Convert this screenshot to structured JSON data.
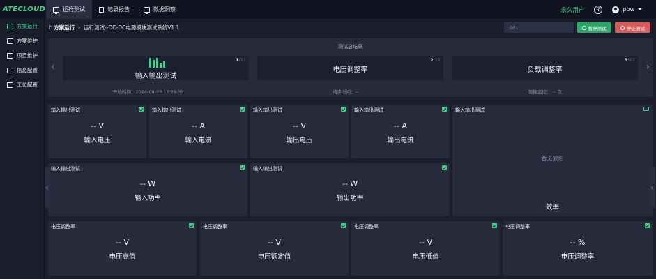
{
  "app": {
    "logo": "ATECLOUD"
  },
  "topnav": [
    {
      "label": "运行测试",
      "icon": "monitor-icon",
      "active": true
    },
    {
      "label": "记录报告",
      "icon": "document-icon",
      "active": false
    },
    {
      "label": "数据洞察",
      "icon": "monitor-icon",
      "active": false
    }
  ],
  "header": {
    "user_type": "永久用户",
    "help": "?",
    "username": "pow"
  },
  "sidebar": [
    {
      "label": "方案运行",
      "active": true
    },
    {
      "label": "方案维护",
      "active": false
    },
    {
      "label": "项目维护",
      "active": false
    },
    {
      "label": "信息配置",
      "active": false
    },
    {
      "label": "工位配置",
      "active": false
    }
  ],
  "breadcrumb": {
    "root": "方案运行",
    "current": "运行测试--DC-DC电源模块测试系统V1.1"
  },
  "search": {
    "value": "001"
  },
  "buttons": {
    "pause": "暂停测试",
    "stop": "停止测试"
  },
  "summary": {
    "title": "测试总结果",
    "stages": [
      {
        "label": "输入输出测试",
        "index": "1",
        "total": "/11"
      },
      {
        "label": "电压调整率",
        "index": "2",
        "total": "/11"
      },
      {
        "label": "负载调整率",
        "index": "3",
        "total": "/11"
      }
    ],
    "start_time": "开始时间：2024-08-23 15:29:32",
    "end_time": "结束时间：--",
    "monitor": "智能监控：  -- 次"
  },
  "cards": [
    {
      "group": "输入输出测试",
      "value": "--  V",
      "name": "输入电压"
    },
    {
      "group": "输入输出测试",
      "value": "--  A",
      "name": "输入电流"
    },
    {
      "group": "输入输出测试",
      "value": "--  V",
      "name": "输出电压"
    },
    {
      "group": "输入输出测试",
      "value": "--  A",
      "name": "输出电流"
    },
    {
      "group": "输入输出测试",
      "value": "--  W",
      "name": "输入功率"
    },
    {
      "group": "输入输出测试",
      "value": "--  W",
      "name": "输出功率"
    },
    {
      "group": "电压调整率",
      "value": "--  V",
      "name": "电压高值"
    },
    {
      "group": "电压调整率",
      "value": "--  V",
      "name": "电压额定值"
    },
    {
      "group": "电压调整率",
      "value": "--  V",
      "name": "电压低值"
    },
    {
      "group": "电压调整率",
      "value": "--  %",
      "name": "电压调整率"
    }
  ],
  "efficiency_card": {
    "group": "输入输出测试",
    "empty": "暂无波形",
    "name": "效率"
  },
  "colors": {
    "accent": "#43d18a",
    "pause": "#2ca56b",
    "stop": "#d65b5b",
    "panel": "#272a3b"
  }
}
